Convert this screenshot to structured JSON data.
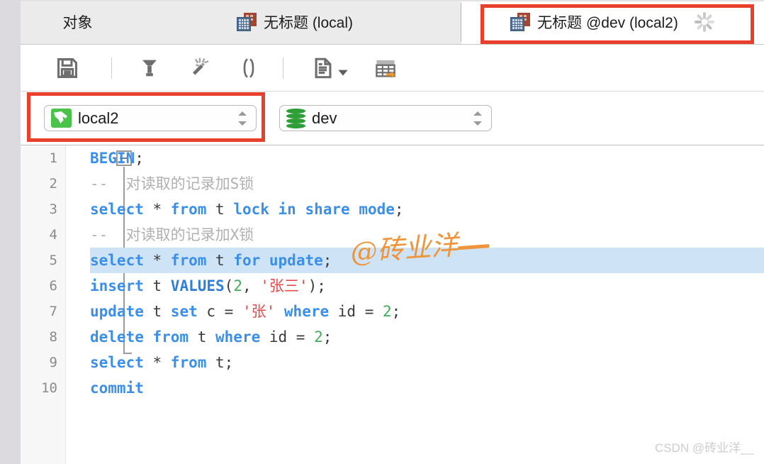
{
  "window": {
    "accent_red": "#e8402a",
    "keyword_blue": "#3b8fe8",
    "string_red": "#e34b4b",
    "number_green": "#3fae55",
    "comment_gray": "#b0b0b0"
  },
  "tabs": [
    {
      "label": "对象",
      "icon": "",
      "active": false,
      "highlighted": false
    },
    {
      "label": "无标题 (local)",
      "icon": "query-table-icon",
      "active": false,
      "highlighted": false
    },
    {
      "label": "无标题 @dev (local2)",
      "icon": "query-table-icon",
      "active": true,
      "highlighted": true,
      "status": "loading-spinner"
    }
  ],
  "toolbar": {
    "items": [
      {
        "name": "save-icon",
        "title": "保存"
      },
      {
        "name": "separator-1",
        "title": ""
      },
      {
        "name": "format-beautify-icon",
        "title": "格式化"
      },
      {
        "name": "magic-wand-icon",
        "title": "美化 SQL"
      },
      {
        "name": "parentheses-icon",
        "title": "()"
      },
      {
        "name": "separator-2",
        "title": ""
      },
      {
        "name": "document-dropdown-icon",
        "title": "文本"
      },
      {
        "name": "export-table-icon",
        "title": "导出"
      }
    ]
  },
  "connection_bar": {
    "connection": {
      "value": "local2",
      "icon": "mysql-dolphin-icon"
    },
    "database": {
      "value": "dev",
      "icon": "database-cylinder-icon"
    },
    "run_button": {
      "name": "run-icon",
      "enabled": false
    },
    "stop_button": {
      "name": "stop-icon",
      "enabled": true
    },
    "explain_button": {
      "name": "explain-plan-icon",
      "enabled": false
    }
  },
  "editor": {
    "selected_line": 5,
    "lines": [
      {
        "num": "1",
        "tokens": [
          {
            "t": "BEGIN",
            "c": "kw"
          },
          {
            "t": ";",
            "c": "pl"
          }
        ]
      },
      {
        "num": "2",
        "tokens": [
          {
            "t": "--  对读取的记录加S锁",
            "c": "cmt"
          }
        ]
      },
      {
        "num": "3",
        "tokens": [
          {
            "t": "select",
            "c": "kw"
          },
          {
            "t": " * ",
            "c": "pl"
          },
          {
            "t": "from",
            "c": "kw"
          },
          {
            "t": " t ",
            "c": "pl"
          },
          {
            "t": "lock in share mode",
            "c": "kw"
          },
          {
            "t": ";",
            "c": "pl"
          }
        ]
      },
      {
        "num": "4",
        "tokens": [
          {
            "t": "--  对读取的记录加X锁",
            "c": "cmt"
          }
        ]
      },
      {
        "num": "5",
        "tokens": [
          {
            "t": "select",
            "c": "kw"
          },
          {
            "t": " * ",
            "c": "pl"
          },
          {
            "t": "from",
            "c": "kw"
          },
          {
            "t": " t ",
            "c": "pl"
          },
          {
            "t": "for update",
            "c": "kw"
          },
          {
            "t": ";",
            "c": "pl"
          }
        ]
      },
      {
        "num": "6",
        "tokens": [
          {
            "t": "insert",
            "c": "kw"
          },
          {
            "t": " t ",
            "c": "pl"
          },
          {
            "t": "VALUES",
            "c": "fn"
          },
          {
            "t": "(",
            "c": "pl"
          },
          {
            "t": "2",
            "c": "num"
          },
          {
            "t": ", ",
            "c": "pl"
          },
          {
            "t": "'张三'",
            "c": "str"
          },
          {
            "t": ");",
            "c": "pl"
          }
        ]
      },
      {
        "num": "7",
        "tokens": [
          {
            "t": "update",
            "c": "kw"
          },
          {
            "t": " t ",
            "c": "pl"
          },
          {
            "t": "set",
            "c": "kw"
          },
          {
            "t": " c = ",
            "c": "pl"
          },
          {
            "t": "'张'",
            "c": "str"
          },
          {
            "t": " ",
            "c": "pl"
          },
          {
            "t": "where",
            "c": "kw"
          },
          {
            "t": " id = ",
            "c": "pl"
          },
          {
            "t": "2",
            "c": "num"
          },
          {
            "t": ";",
            "c": "pl"
          }
        ]
      },
      {
        "num": "8",
        "tokens": [
          {
            "t": "delete from",
            "c": "kw"
          },
          {
            "t": " t ",
            "c": "pl"
          },
          {
            "t": "where",
            "c": "kw"
          },
          {
            "t": " id = ",
            "c": "pl"
          },
          {
            "t": "2",
            "c": "num"
          },
          {
            "t": ";",
            "c": "pl"
          }
        ]
      },
      {
        "num": "9",
        "tokens": [
          {
            "t": "select",
            "c": "kw"
          },
          {
            "t": " * ",
            "c": "pl"
          },
          {
            "t": "from",
            "c": "kw"
          },
          {
            "t": " t;",
            "c": "pl"
          }
        ]
      },
      {
        "num": "10",
        "tokens": [
          {
            "t": "commit",
            "c": "kw"
          }
        ]
      }
    ]
  },
  "watermarks": {
    "center": "@砖业洋",
    "corner": "CSDN @砖业洋__"
  }
}
